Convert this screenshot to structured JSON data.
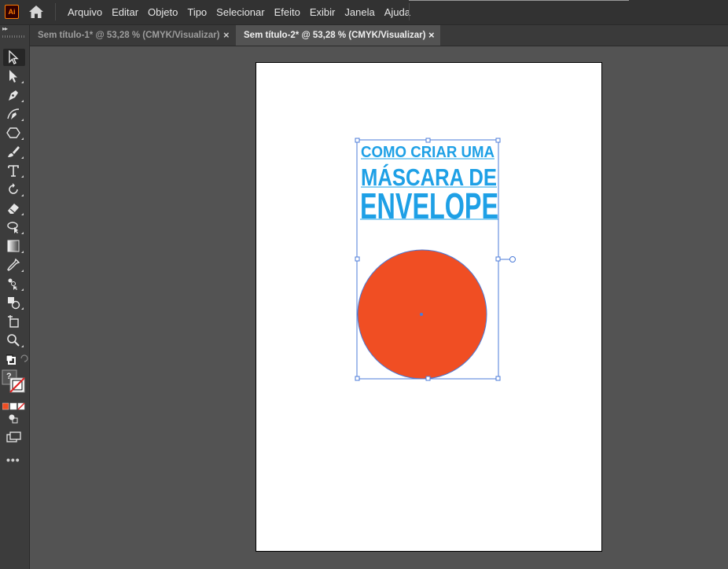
{
  "app": {
    "logo_text": "Ai"
  },
  "menu": {
    "items": [
      "Arquivo",
      "Editar",
      "Objeto",
      "Tipo",
      "Selecionar",
      "Efeito",
      "Exibir",
      "Janela",
      "Ajuda"
    ]
  },
  "tabs": [
    {
      "label": "Sem título-1* @ 53,28 % (CMYK/Visualizar)",
      "close": "×",
      "active": false
    },
    {
      "label": "Sem título-2* @ 53,28 % (CMYK/Visualizar)",
      "close": "×",
      "active": true
    }
  ],
  "toolbar": {
    "collapse": "▸▸",
    "tools": [
      "selection-tool-icon",
      "direct-selection-tool-icon",
      "pen-tool-icon",
      "curvature-tool-icon",
      "shape-tool-icon",
      "paintbrush-tool-icon",
      "type-tool-icon",
      "rotate-tool-icon",
      "eraser-tool-icon",
      "warp-tool-icon",
      "gradient-tool-icon",
      "eyedropper-tool-icon",
      "blend-tool-icon",
      "shape-builder-tool-icon",
      "artboard-tool-icon",
      "zoom-tool-icon"
    ],
    "fill_stroke_question": "?",
    "more": "•••"
  },
  "artwork": {
    "title_lines": [
      "COMO CRIAR UMA",
      "MÁSCARA DE",
      "ENVELOPE"
    ],
    "title_color": "#1ea0e6",
    "circle_color": "#f04e23",
    "selection_color": "#4b7bd8"
  }
}
